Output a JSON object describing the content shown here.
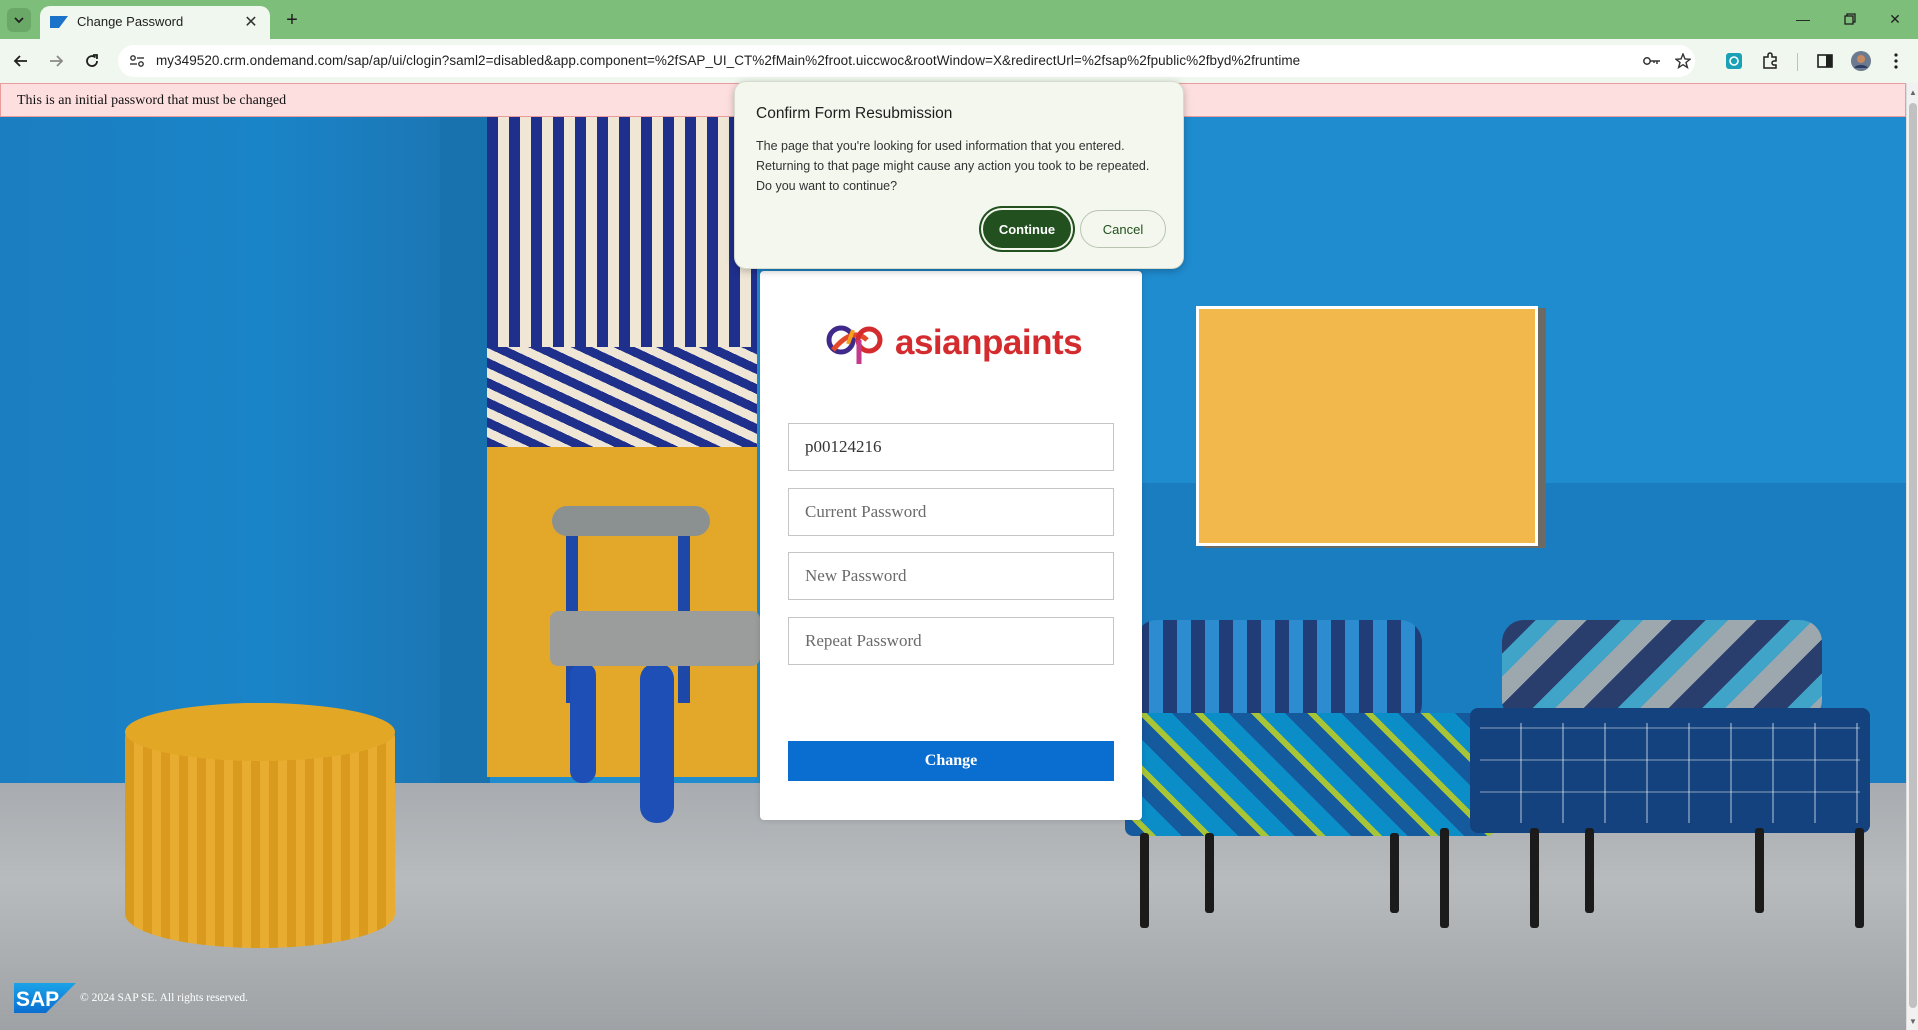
{
  "browser": {
    "tab_title": "Change Password",
    "url": "my349520.crm.ondemand.com/sap/ap/ui/clogin?saml2=disabled&app.component=%2fSAP_UI_CT%2fMain%2froot.uiccwoc&rootWindow=X&redirectUrl=%2fsap%2fpublic%2fbyd%2fruntime"
  },
  "banner": {
    "message": "This is an initial password that must be changed"
  },
  "dialog": {
    "title": "Confirm Form Resubmission",
    "body": "The page that you're looking for used information that you entered. Returning to that page might cause any action you took to be repeated. Do you want to continue?",
    "continue_label": "Continue",
    "cancel_label": "Cancel"
  },
  "login": {
    "logo_text": "asianpaints",
    "username_value": "p00124216",
    "current_password_placeholder": "Current Password",
    "new_password_placeholder": "New Password",
    "repeat_password_placeholder": "Repeat Password",
    "change_label": "Change"
  },
  "footer": {
    "sap_logo_text": "SAP",
    "copyright": "© 2024 SAP SE. All rights reserved."
  },
  "colors": {
    "tabbar": "#7dbe7b",
    "change_button": "#0a6ed1",
    "continue_button": "#22501e",
    "banner_bg": "#fddfdf",
    "logo_red": "#d42b2e"
  }
}
